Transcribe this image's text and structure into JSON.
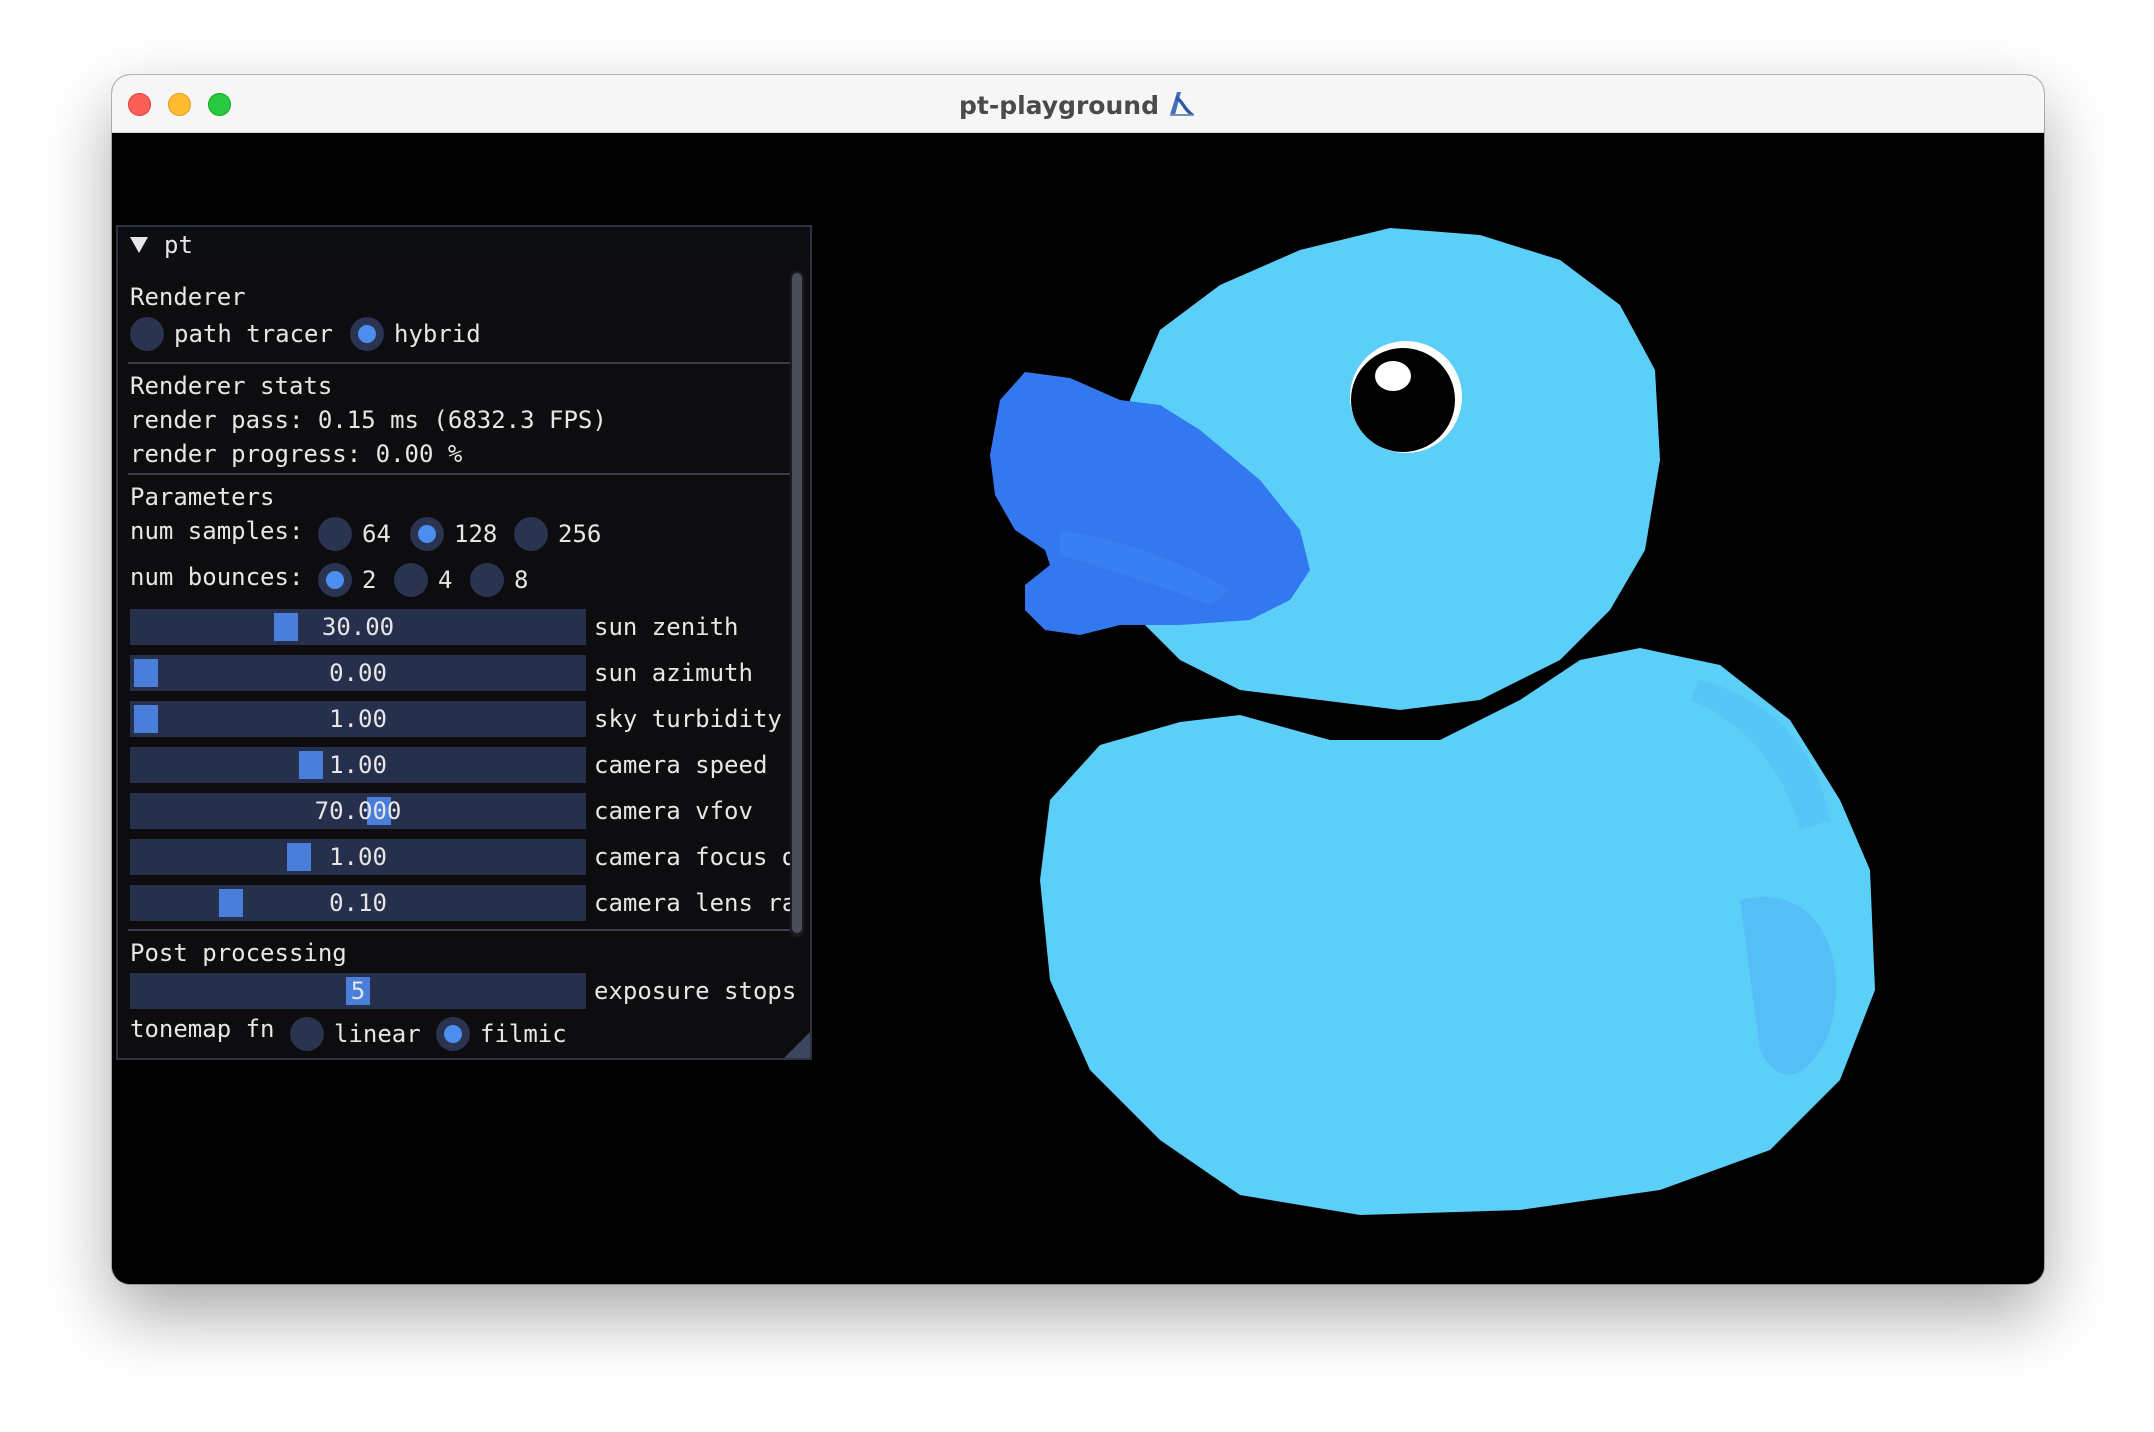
{
  "window": {
    "title": "pt-playground",
    "title_icon": "slide-emoji"
  },
  "panel": {
    "header": "pt",
    "renderer": {
      "heading": "Renderer",
      "options": [
        "path tracer",
        "hybrid"
      ],
      "selected": "hybrid"
    },
    "stats": {
      "heading": "Renderer stats",
      "render_pass": "render pass: 0.15 ms (6832.3 FPS)",
      "render_progress": "render progress: 0.00 %"
    },
    "parameters": {
      "heading": "Parameters",
      "num_samples": {
        "label": "num samples:",
        "options": [
          "64",
          "128",
          "256"
        ],
        "selected": "128"
      },
      "num_bounces": {
        "label": "num bounces:",
        "options": [
          "2",
          "4",
          "8"
        ],
        "selected": "2"
      },
      "sliders": [
        {
          "label": "sun zenith",
          "value": "30.00",
          "fraction": 0.33
        },
        {
          "label": "sun azimuth",
          "value": "0.00",
          "fraction": 0.0
        },
        {
          "label": "sky turbidity",
          "value": "1.00",
          "fraction": 0.0
        },
        {
          "label": "camera speed",
          "value": "1.00",
          "fraction": 0.39
        },
        {
          "label": "camera vfov",
          "value": "70.000",
          "fraction": 0.55
        },
        {
          "label": "camera focus d",
          "value": "1.00",
          "fraction": 0.36
        },
        {
          "label": "camera lens ra",
          "value": "0.10",
          "fraction": 0.2
        }
      ]
    },
    "post": {
      "heading": "Post processing",
      "exposure": {
        "label": "exposure stops",
        "value": "5",
        "fraction": 0.5
      },
      "tonemap": {
        "label": "tonemap fn",
        "options": [
          "linear",
          "filmic"
        ],
        "selected": "filmic"
      }
    }
  },
  "colors": {
    "duck_body": "#5ccff8",
    "duck_beak": "#3478f0",
    "accent": "#4c8eef",
    "frame": "#26304c"
  }
}
